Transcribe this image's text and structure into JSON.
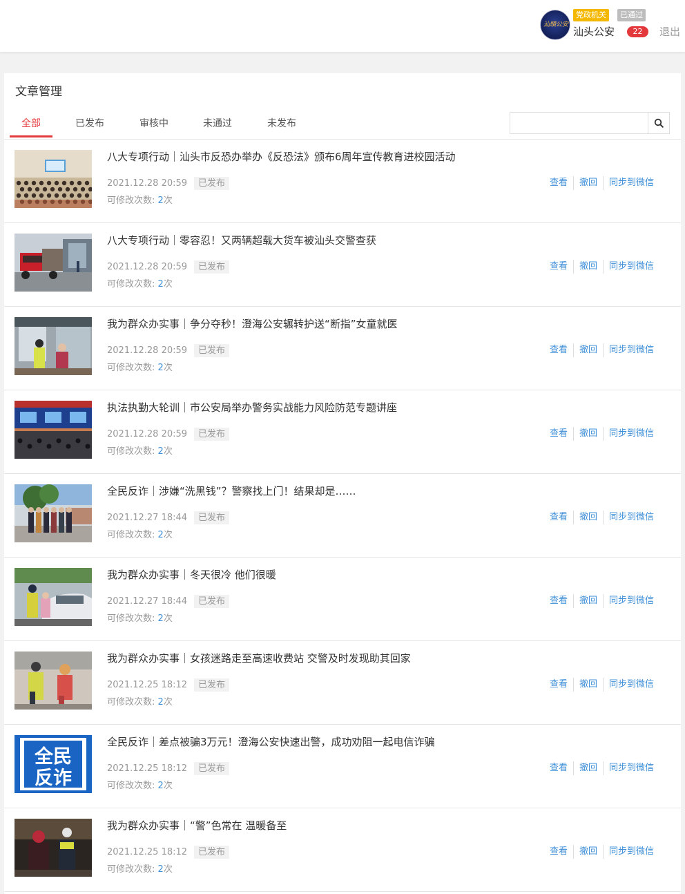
{
  "header": {
    "badge_party": "党政机关",
    "badge_status": "已通过",
    "account_name": "汕头公安",
    "avatar_text": "汕頭公安",
    "notification_count": "22",
    "logout_label": "退出"
  },
  "panel": {
    "title": "文章管理",
    "tabs": [
      {
        "label": "全部"
      },
      {
        "label": "已发布"
      },
      {
        "label": "审核中"
      },
      {
        "label": "未通过"
      },
      {
        "label": "未发布"
      }
    ],
    "search_placeholder": ""
  },
  "labels": {
    "edit_prefix": "可修改次数:",
    "edit_suffix": "次",
    "view": "查看",
    "revoke": "撤回",
    "sync": "同步到微信"
  },
  "articles": [
    {
      "title": "八大专项行动｜汕头市反恐办举办《反恐法》颁布6周年宣传教育进校园活动",
      "time": "2021.12.28 20:59",
      "status": "已发布",
      "edit_count": "2",
      "thumb": "auditorium"
    },
    {
      "title": "八大专项行动｜零容忍！又两辆超载大货车被汕头交警查获",
      "time": "2021.12.28 20:59",
      "status": "已发布",
      "edit_count": "2",
      "thumb": "truck"
    },
    {
      "title": "我为群众办实事｜争分夺秒！澄海公安辗转护送“断指”女童就医",
      "time": "2021.12.28 20:59",
      "status": "已发布",
      "edit_count": "2",
      "thumb": "hospital"
    },
    {
      "title": "执法执勤大轮训｜市公安局举办警务实战能力风险防范专题讲座",
      "time": "2021.12.28 20:59",
      "status": "已发布",
      "edit_count": "2",
      "thumb": "conference"
    },
    {
      "title": "全民反诈｜涉嫌“洗黑钱”？警察找上门！结果却是……",
      "time": "2021.12.27 18:44",
      "status": "已发布",
      "edit_count": "2",
      "thumb": "street"
    },
    {
      "title": "我为群众办实事｜冬天很冷 他们很暖",
      "time": "2021.12.27 18:44",
      "status": "已发布",
      "edit_count": "2",
      "thumb": "car"
    },
    {
      "title": "我为群众办实事｜女孩迷路走至高速收费站 交警及时发现助其回家",
      "time": "2021.12.25 18:12",
      "status": "已发布",
      "edit_count": "2",
      "thumb": "girl"
    },
    {
      "title": "全民反诈｜差点被骗3万元！澄海公安快速出警，成功劝阻一起电信诈骗",
      "time": "2021.12.25 18:12",
      "status": "已发布",
      "edit_count": "2",
      "thumb": "poster",
      "thumb_text_1": "全民",
      "thumb_text_2": "反诈"
    },
    {
      "title": "我为群众办实事｜“警”色常在 温暖备至",
      "time": "2021.12.25 18:12",
      "status": "已发布",
      "edit_count": "2",
      "thumb": "night"
    }
  ]
}
